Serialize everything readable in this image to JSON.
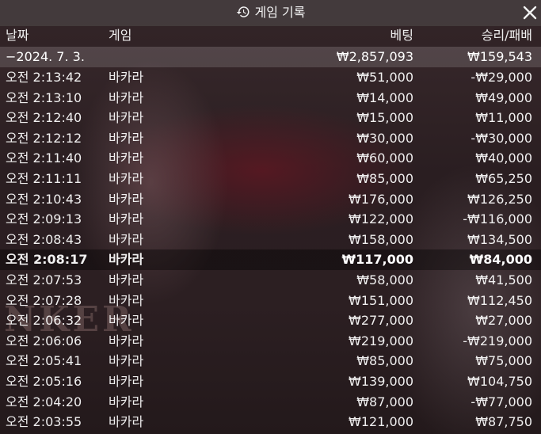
{
  "title": "게임 기록",
  "columns": {
    "date": "날짜",
    "game": "게임",
    "bet": "베팅",
    "win_loss": "승리/패배"
  },
  "summary": {
    "date": "−2024. 7. 3.",
    "bet": "₩2,857,093",
    "win_loss": "₩159,543"
  },
  "rows": [
    {
      "time": "오전 2:13:42",
      "game": "바카라",
      "bet": "₩51,000",
      "win_loss": "-₩29,000"
    },
    {
      "time": "오전 2:13:10",
      "game": "바카라",
      "bet": "₩14,000",
      "win_loss": "₩49,000"
    },
    {
      "time": "오전 2:12:40",
      "game": "바카라",
      "bet": "₩15,000",
      "win_loss": "₩11,000"
    },
    {
      "time": "오전 2:12:12",
      "game": "바카라",
      "bet": "₩30,000",
      "win_loss": "-₩30,000"
    },
    {
      "time": "오전 2:11:40",
      "game": "바카라",
      "bet": "₩60,000",
      "win_loss": "₩40,000"
    },
    {
      "time": "오전 2:11:11",
      "game": "바카라",
      "bet": "₩85,000",
      "win_loss": "₩65,250"
    },
    {
      "time": "오전 2:10:43",
      "game": "바카라",
      "bet": "₩176,000",
      "win_loss": "₩126,250"
    },
    {
      "time": "오전 2:09:13",
      "game": "바카라",
      "bet": "₩122,000",
      "win_loss": "-₩116,000"
    },
    {
      "time": "오전 2:08:43",
      "game": "바카라",
      "bet": "₩158,000",
      "win_loss": "₩134,500"
    },
    {
      "time": "오전 2:08:17",
      "game": "바카라",
      "bet": "₩117,000",
      "win_loss": "₩84,000"
    },
    {
      "time": "오전 2:07:53",
      "game": "바카라",
      "bet": "₩58,000",
      "win_loss": "₩41,500"
    },
    {
      "time": "오전 2:07:28",
      "game": "바카라",
      "bet": "₩151,000",
      "win_loss": "₩112,450"
    },
    {
      "time": "오전 2:06:32",
      "game": "바카라",
      "bet": "₩277,000",
      "win_loss": "₩27,000"
    },
    {
      "time": "오전 2:06:06",
      "game": "바카라",
      "bet": "₩219,000",
      "win_loss": "-₩219,000"
    },
    {
      "time": "오전 2:05:41",
      "game": "바카라",
      "bet": "₩85,000",
      "win_loss": "₩75,000"
    },
    {
      "time": "오전 2:05:16",
      "game": "바카라",
      "bet": "₩139,000",
      "win_loss": "₩104,750"
    },
    {
      "time": "오전 2:04:20",
      "game": "바카라",
      "bet": "₩87,000",
      "win_loss": "-₩77,000"
    },
    {
      "time": "오전 2:03:55",
      "game": "바카라",
      "bet": "₩121,000",
      "win_loss": "₩87,750"
    }
  ],
  "highlighted_row": 9,
  "background_text": "NKER",
  "icons": {
    "title": "history-icon",
    "close": "close-icon"
  },
  "colors": {
    "topbar": "#463e40",
    "text": "#ffffff",
    "summary_row": "#5a5052"
  }
}
